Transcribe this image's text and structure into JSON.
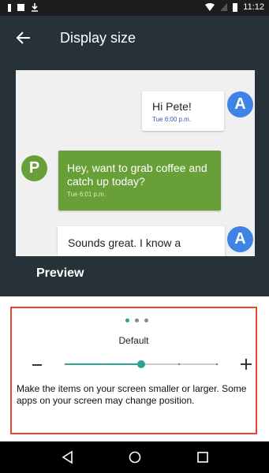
{
  "status_bar": {
    "time": "11:12"
  },
  "toolbar": {
    "title": "Display size",
    "back_icon": "back-arrow-icon"
  },
  "chat": {
    "messages": [
      {
        "text": "Hi Pete!",
        "time": "Tue 6:00 p.m.",
        "avatar": "A",
        "side": "right"
      },
      {
        "text": "Hey, want to grab coffee and catch up today?",
        "time": "Tue 6:01 p.m.",
        "avatar": "P",
        "side": "left"
      },
      {
        "text": "Sounds great. I know a",
        "avatar": "A",
        "side": "right"
      }
    ]
  },
  "preview": {
    "label": "Preview"
  },
  "display_size": {
    "label": "Default",
    "description": "Make the items on your screen smaller or larger. Some apps on your screen may change position.",
    "slider_level": 0.5,
    "steps": 5,
    "dots_total": 3,
    "dots_active": 1
  },
  "colors": {
    "toolbar": "#263238",
    "accent": "#2aa38f",
    "green_bubble": "#689f38",
    "blue_avatar": "#3f84e5",
    "highlight_border": "#e8462f"
  },
  "nav_bar": {
    "icons": [
      "back-triangle-icon",
      "home-circle-icon",
      "recents-square-icon"
    ]
  }
}
